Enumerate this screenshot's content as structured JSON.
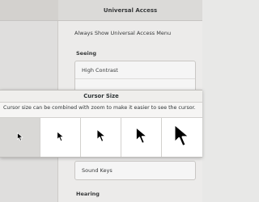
{
  "window": {
    "header_title": "Universal Access"
  },
  "settings": {
    "always_show_label": "Always Show Universal Access Menu",
    "seeing_heading": "Seeing",
    "seeing_rows": [
      "High Contrast",
      ""
    ],
    "sound_keys_label": "Sound Keys",
    "hearing_heading": "Hearing"
  },
  "dialog": {
    "title": "Cursor Size",
    "description": "Cursor size can be combined with zoom to make it easier to see the cursor.",
    "sizes": [
      {
        "label": "",
        "selected": true
      },
      {
        "label": "",
        "selected": false
      },
      {
        "label": "",
        "selected": false
      },
      {
        "label": "",
        "selected": false
      },
      {
        "label": "",
        "selected": false
      }
    ]
  },
  "colors": {
    "dialog_bg": "#f6f5f4",
    "selected_bg": "#d9d8d6",
    "cursor_fill": "#000000",
    "cursor_outline": "#ffffff"
  }
}
